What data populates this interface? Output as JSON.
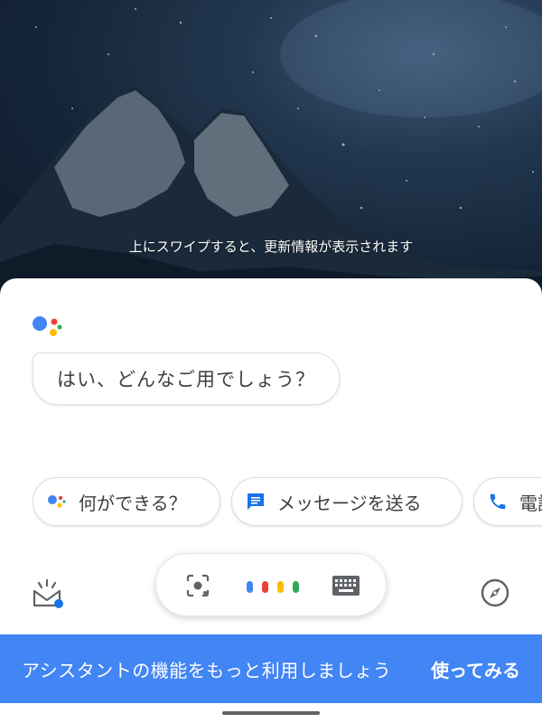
{
  "wallpaper": {
    "swipe_hint": "上にスワイプすると、更新情報が表示されます"
  },
  "assistant": {
    "logo_icon": "google-assistant-icon",
    "greeting": "はい、どんなご用でしょう？",
    "suggestions": [
      {
        "label": "何ができる？",
        "icon": "google-assistant-icon"
      },
      {
        "label": "メッセージを送る",
        "icon": "message-icon"
      },
      {
        "label": "電話",
        "icon": "phone-icon"
      }
    ]
  },
  "input_bar": {
    "updates_icon": "snapshot-updates-icon",
    "lens_icon": "lens-icon",
    "mic_icon": "assistant-mic-dots-icon",
    "keyboard_icon": "keyboard-icon",
    "explore_icon": "compass-icon"
  },
  "banner": {
    "text": "アシスタントの機能をもっと利用しましょう",
    "action": "使ってみる"
  },
  "colors": {
    "accent_blue": "#4285f4",
    "red": "#ea4335",
    "yellow": "#fbbc05",
    "green": "#34a853"
  }
}
